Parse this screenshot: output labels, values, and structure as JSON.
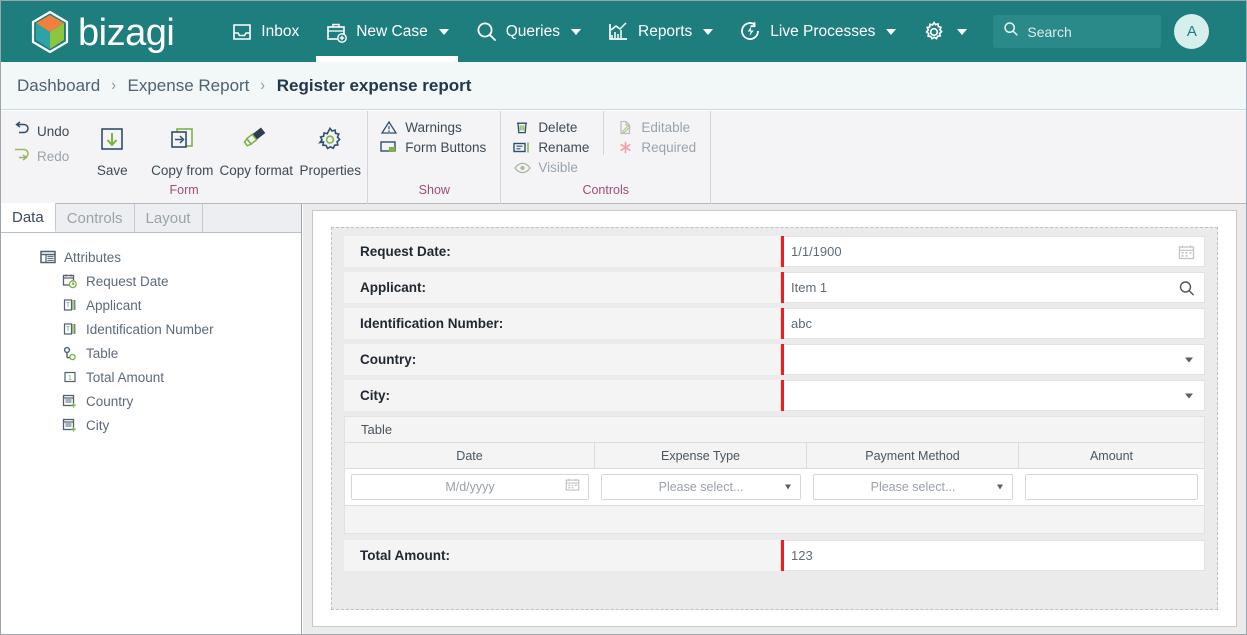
{
  "brand": {
    "name": "bizagi",
    "logo_icon": "bizagi-cube-logo"
  },
  "topnav": {
    "items": [
      {
        "label": "Inbox",
        "icon": "inbox-icon",
        "caret": false,
        "active": false
      },
      {
        "label": "New Case",
        "icon": "briefcase-plus-icon",
        "caret": true,
        "active": true
      },
      {
        "label": "Queries",
        "icon": "magnifier-icon",
        "caret": true,
        "active": false
      },
      {
        "label": "Reports",
        "icon": "bar-chart-icon",
        "caret": true,
        "active": false
      },
      {
        "label": "Live Processes",
        "icon": "refresh-bolt-icon",
        "caret": true,
        "active": false
      }
    ],
    "settings": {
      "icon": "gear-icon",
      "caret": true
    },
    "search": {
      "placeholder": "Search",
      "icon": "search-icon"
    },
    "avatar": {
      "initial": "A"
    },
    "colors": {
      "bar": "#1e7e7e",
      "search_field": "#2a8a8a",
      "avatar_bg": "#d6eeec"
    }
  },
  "breadcrumb": {
    "separator": "›",
    "items": [
      {
        "label": "Dashboard",
        "current": false
      },
      {
        "label": "Expense Report",
        "current": false
      },
      {
        "label": "Register expense report",
        "current": true
      }
    ]
  },
  "ribbon": {
    "groups": [
      {
        "title": "Form",
        "undo_redo": [
          {
            "label": "Undo",
            "icon": "undo-arrow-icon",
            "enabled": true
          },
          {
            "label": "Redo",
            "icon": "redo-arrow-icon",
            "enabled": false
          }
        ],
        "buttons": [
          {
            "label": "Save",
            "icon": "save-download-icon"
          },
          {
            "label": "Copy from",
            "icon": "copy-from-icon"
          },
          {
            "label": "Copy format",
            "icon": "format-brush-icon"
          },
          {
            "label": "Properties",
            "icon": "gear-properties-icon"
          }
        ]
      },
      {
        "title": "Show",
        "items": [
          {
            "label": "Warnings",
            "icon": "warning-triangle-icon",
            "enabled": true
          },
          {
            "label": "Form Buttons",
            "icon": "form-buttons-icon",
            "enabled": true
          }
        ]
      },
      {
        "title": "Controls",
        "col1": [
          {
            "label": "Delete",
            "icon": "trash-icon",
            "enabled": true
          },
          {
            "label": "Rename",
            "icon": "rename-icon",
            "enabled": true
          },
          {
            "label": "Visible",
            "icon": "eye-icon",
            "enabled": false
          }
        ],
        "col2": [
          {
            "label": "Editable",
            "icon": "editable-pencil-icon",
            "enabled": false
          },
          {
            "label": "Required",
            "icon": "required-asterisk-icon",
            "enabled": false
          }
        ]
      }
    ],
    "group_title_color": "#9c4f77"
  },
  "left_panel": {
    "tabs": [
      {
        "label": "Data",
        "active": true
      },
      {
        "label": "Controls",
        "active": false
      },
      {
        "label": "Layout",
        "active": false
      }
    ],
    "tree": [
      {
        "label": "Attributes",
        "icon": "attributes-table-icon",
        "level": "root"
      },
      {
        "label": "Request Date",
        "icon": "date-time-icon",
        "level": "child"
      },
      {
        "label": "Applicant",
        "icon": "text-field-icon",
        "level": "child"
      },
      {
        "label": "Identification Number",
        "icon": "text-field-icon",
        "level": "child"
      },
      {
        "label": "Table",
        "icon": "collection-icon",
        "level": "child"
      },
      {
        "label": "Total Amount",
        "icon": "number-field-icon",
        "level": "child"
      },
      {
        "label": "Country",
        "icon": "parameter-entity-icon",
        "level": "child"
      },
      {
        "label": "City",
        "icon": "parameter-entity-icon",
        "level": "child"
      }
    ]
  },
  "form": {
    "required_marker_color": "#ee1c25",
    "fields": [
      {
        "label": "Request Date:",
        "value": "1/1/1900",
        "type": "date",
        "icon": "calendar-icon",
        "required": true
      },
      {
        "label": "Applicant:",
        "value": "Item 1",
        "type": "search",
        "icon": "magnifier-icon",
        "required": true
      },
      {
        "label": "Identification Number:",
        "value": "abc",
        "type": "text",
        "icon": "",
        "required": true
      },
      {
        "label": "Country:",
        "value": "",
        "type": "dropdown",
        "icon": "chevron-down-icon",
        "required": true
      },
      {
        "label": "City:",
        "value": "",
        "type": "dropdown",
        "icon": "chevron-down-icon",
        "required": true
      }
    ],
    "table": {
      "title": "Table",
      "columns": [
        "Date",
        "Expense Type",
        "Payment Method",
        "Amount"
      ],
      "rows": [
        {
          "date": {
            "placeholder": "M/d/yyyy",
            "icon": "calendar-icon"
          },
          "expense_type": {
            "placeholder": "Please select...",
            "icon": "chevron-down-icon"
          },
          "payment_method": {
            "placeholder": "Please select...",
            "icon": "chevron-down-icon"
          },
          "amount": {
            "placeholder": ""
          }
        }
      ]
    },
    "total": {
      "label": "Total Amount:",
      "value": "123",
      "required": true
    }
  }
}
